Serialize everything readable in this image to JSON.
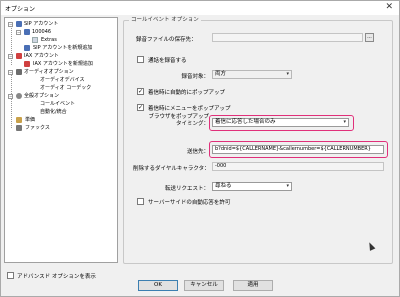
{
  "window": {
    "title": "オプション",
    "close_glyph": "✕"
  },
  "tree": {
    "items": [
      {
        "label": "SIP アカウント",
        "icon": "phone-icon"
      },
      {
        "label": "100046",
        "icon": "phone-icon"
      },
      {
        "label": "Extras",
        "icon": "blank-icon"
      },
      {
        "label": "SIP アカウントを新規追加",
        "icon": "phone-add-icon"
      },
      {
        "label": "IAX アカウント",
        "icon": "iax-icon"
      },
      {
        "label": "IAX アカウントを新規追加",
        "icon": "iax-add-icon"
      },
      {
        "label": "オーディオオプション",
        "icon": "audio-icon"
      },
      {
        "label": "オーディオデバイス",
        "icon": ""
      },
      {
        "label": "オーディオ コーデック",
        "icon": ""
      },
      {
        "label": "全般オプション",
        "icon": "gear-icon"
      },
      {
        "label": "コールイベント",
        "icon": ""
      },
      {
        "label": "自動化/統合",
        "icon": ""
      },
      {
        "label": "単価",
        "icon": "note-icon"
      },
      {
        "label": "ファックス",
        "icon": "fax-icon"
      }
    ]
  },
  "advanced": {
    "label": "アドバンスド オプションを表示",
    "checked": false
  },
  "panel": {
    "group_title": "コールイベント オプション",
    "save_path": {
      "label": "録音ファイルの保存先：",
      "value": "",
      "browse": "..."
    },
    "record_calls": {
      "label": "通話を録音する",
      "checked": false
    },
    "record_target": {
      "label": "録音対象：",
      "value": "両方"
    },
    "popup_on_incoming": {
      "label": "着信時に自動的にポップアップ",
      "checked": true
    },
    "menu_popup": {
      "label": "着信時にメニューをポップアップ",
      "checked": true
    },
    "browser_timing": {
      "label_line1": "ブラウザをポップアップ",
      "label_line2": "タイミング：",
      "value": "着信に応答した場合のみ"
    },
    "url": {
      "label": "送信先：",
      "value": "b?dnid=${CALLERNAME}&callernumber=${CALLERNUMBER}"
    },
    "strip_chars": {
      "label": "削除するダイヤルキャラクタ：",
      "value": "-000"
    },
    "transfer": {
      "label": "転送リクエスト：",
      "value": "尋ねる"
    },
    "auto_answer": {
      "label": "サーバーサイドの自動応答を許可",
      "checked": false
    }
  },
  "buttons": {
    "ok": "OK",
    "cancel": "キャンセル",
    "apply": "適用"
  },
  "colors": {
    "highlight": "#e0307a",
    "check_mark": "✓"
  }
}
